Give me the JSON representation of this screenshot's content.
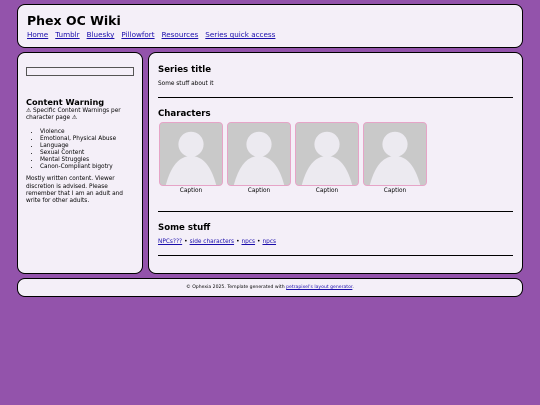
{
  "header": {
    "title": "Phex OC Wiki",
    "nav": [
      "Home",
      "Tumblr",
      "Bluesky",
      "Pillowfort",
      "Resources",
      "Series quick access"
    ]
  },
  "sidebar": {
    "cw_title": "Content Warning",
    "cw_note": "⚠ Specific Content Warnings per character page ⚠",
    "cw_items": [
      "Violence",
      "Emotional, Physical Abuse",
      "Language",
      "Sexual Content",
      "Mental Struggles",
      "Canon-Compliant bigotry"
    ],
    "cw_para": "Mostly written content. Viewer discretion is advised. Please remember that I am an adult and write for other adults."
  },
  "main": {
    "series_title": "Series title",
    "series_desc": "Some stuff about it",
    "chars_title": "Characters",
    "captions": [
      "Caption",
      "Caption",
      "Caption",
      "Caption"
    ],
    "stuff_title": "Some stuff",
    "stuff_links": [
      "NPCs???",
      "side characters",
      "npcs",
      "npcs"
    ],
    "separator": "•"
  },
  "footer": {
    "prefix": "© Ophexia 2025. Template generated with ",
    "link": "petrapixel's layout generator",
    "suffix": "."
  },
  "colors": {
    "background": "#9353ab",
    "panel": "#f4eff8",
    "card_border": "#e6a4c7",
    "placeholder": "#c9c9c9"
  }
}
